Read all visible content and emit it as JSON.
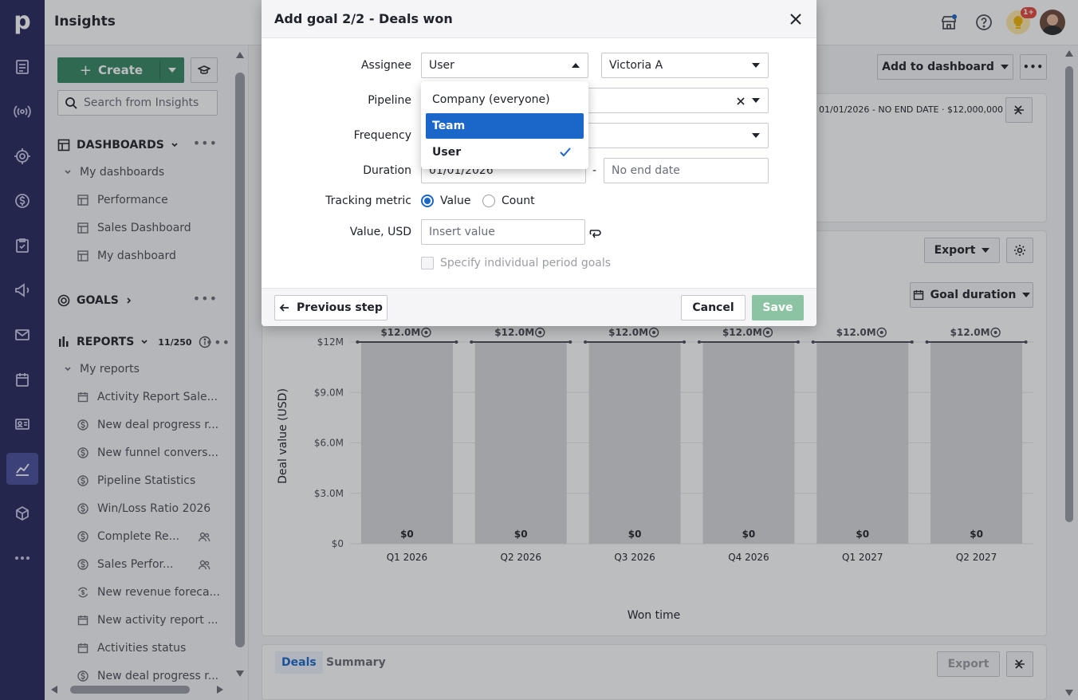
{
  "app": {
    "title": "Insights"
  },
  "topbar": {
    "notification_badge": "1+"
  },
  "sidebar": {
    "create_label": "Create",
    "search_placeholder": "Search from Insights",
    "dashboards_label": "DASHBOARDS",
    "my_dashboards_label": "My dashboards",
    "dashboards": [
      "Performance",
      "Sales Dashboard",
      "My dashboard"
    ],
    "goals_label": "GOALS",
    "reports_label": "REPORTS",
    "reports_count": "11/250",
    "my_reports_label": "My reports",
    "reports": [
      {
        "label": "Activity Report Sale...",
        "icon": "calendar-icon",
        "shared": false
      },
      {
        "label": "New deal progress r...",
        "icon": "dollar-icon",
        "shared": false
      },
      {
        "label": "New funnel convers...",
        "icon": "dollar-icon",
        "shared": false
      },
      {
        "label": "Pipeline Statistics",
        "icon": "dollar-icon",
        "shared": false
      },
      {
        "label": "Win/Loss Ratio 2026",
        "icon": "dollar-icon",
        "shared": false
      },
      {
        "label": "Complete Re...",
        "icon": "dollar-icon",
        "shared": true
      },
      {
        "label": "Sales Perfor...",
        "icon": "dollar-icon",
        "shared": true
      },
      {
        "label": "New revenue foreca...",
        "icon": "recurring-dollar-icon",
        "shared": false
      },
      {
        "label": "New activity report ...",
        "icon": "calendar-icon",
        "shared": false
      },
      {
        "label": "Activities status",
        "icon": "calendar-icon",
        "shared": false
      },
      {
        "label": "New deal progress r...",
        "icon": "dollar-icon",
        "shared": false
      }
    ]
  },
  "main": {
    "add_to_dashboard_label": "Add to dashboard",
    "goal_summary": "01/01/2026 - NO END DATE",
    "goal_amount": "$12,000,000",
    "export_label": "Export",
    "goal_duration_label": "Goal duration",
    "bottom_tabs": [
      "Deals",
      "Summary"
    ],
    "bottom_export_label": "Export"
  },
  "chart_data": {
    "type": "bar",
    "categories": [
      "Q1 2026",
      "Q2 2026",
      "Q3 2026",
      "Q4 2026",
      "Q1 2027",
      "Q2 2027"
    ],
    "values": [
      0,
      0,
      0,
      0,
      0,
      0
    ],
    "value_labels": [
      "$0",
      "$0",
      "$0",
      "$0",
      "$0",
      "$0"
    ],
    "goal_values": [
      12000000,
      12000000,
      12000000,
      12000000,
      12000000,
      12000000
    ],
    "goal_labels": [
      "$12.0M",
      "$12.0M",
      "$12.0M",
      "$12.0M",
      "$12.0M",
      "$12.0M"
    ],
    "ylabel": "Deal value (USD)",
    "xlabel": "Won time",
    "y_ticks": [
      0,
      3000000,
      6000000,
      9000000,
      12000000
    ],
    "y_tick_labels": [
      "$0",
      "$3.0M",
      "$6.0M",
      "$9.0M",
      "$12M"
    ],
    "ylim": [
      0,
      12000000
    ],
    "grid": true
  },
  "modal": {
    "title": "Add goal 2/2 - Deals won",
    "assignee_label": "Assignee",
    "assignee_type": "User",
    "assignee_value": "Victoria A",
    "pipeline_label": "Pipeline",
    "frequency_label": "Frequency",
    "duration_label": "Duration",
    "duration_start": "01/01/2026",
    "duration_sep": "-",
    "duration_end_placeholder": "No end date",
    "tracking_label": "Tracking metric",
    "tracking_value_label": "Value",
    "tracking_count_label": "Count",
    "value_label": "Value, USD",
    "value_placeholder": "Insert value",
    "period_goals_label": "Specify individual period goals",
    "prev_label": "Previous step",
    "cancel_label": "Cancel",
    "save_label": "Save"
  },
  "dropdown": {
    "options": [
      "Company (everyone)",
      "Team",
      "User"
    ],
    "highlighted": "Team",
    "selected": "User"
  }
}
